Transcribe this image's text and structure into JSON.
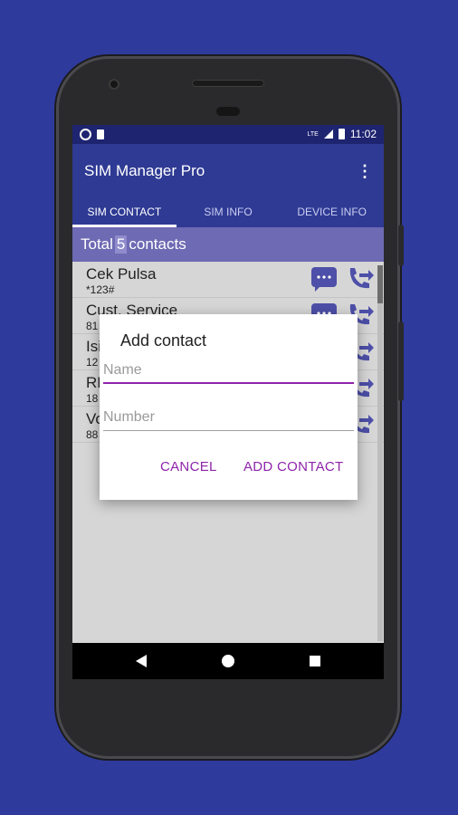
{
  "status_bar": {
    "time": "11:02",
    "network": "LTE",
    "icons": [
      "circle-icon",
      "sim-icon",
      "signal-icon",
      "battery-icon"
    ]
  },
  "app_bar": {
    "title": "SIM Manager Pro",
    "menu_icon": "more-vert-icon"
  },
  "tabs": [
    {
      "label": "SIM CONTACT",
      "active": true
    },
    {
      "label": "SIM INFO",
      "active": false
    },
    {
      "label": "DEVICE INFO",
      "active": false
    }
  ],
  "total": {
    "prefix": "Total",
    "count": "5",
    "suffix": "contacts"
  },
  "contacts": [
    {
      "name": "Cek Pulsa",
      "number": "*123#"
    },
    {
      "name": "Cust. Service",
      "number": "81"
    },
    {
      "name": "Isi",
      "number": "12"
    },
    {
      "name": "RE",
      "number": "18"
    },
    {
      "name": "Vo",
      "number": "88"
    }
  ],
  "dialog": {
    "title": "Add contact",
    "name_placeholder": "Name",
    "number_placeholder": "Number",
    "cancel_label": "CANCEL",
    "add_label": "ADD CONTACT"
  },
  "colors": {
    "background": "#2e3a9c",
    "app_bar": "#2f3a94",
    "accent": "#8e24aa",
    "total_bar": "#6e6ab3",
    "icon": "#4d4fa8"
  }
}
